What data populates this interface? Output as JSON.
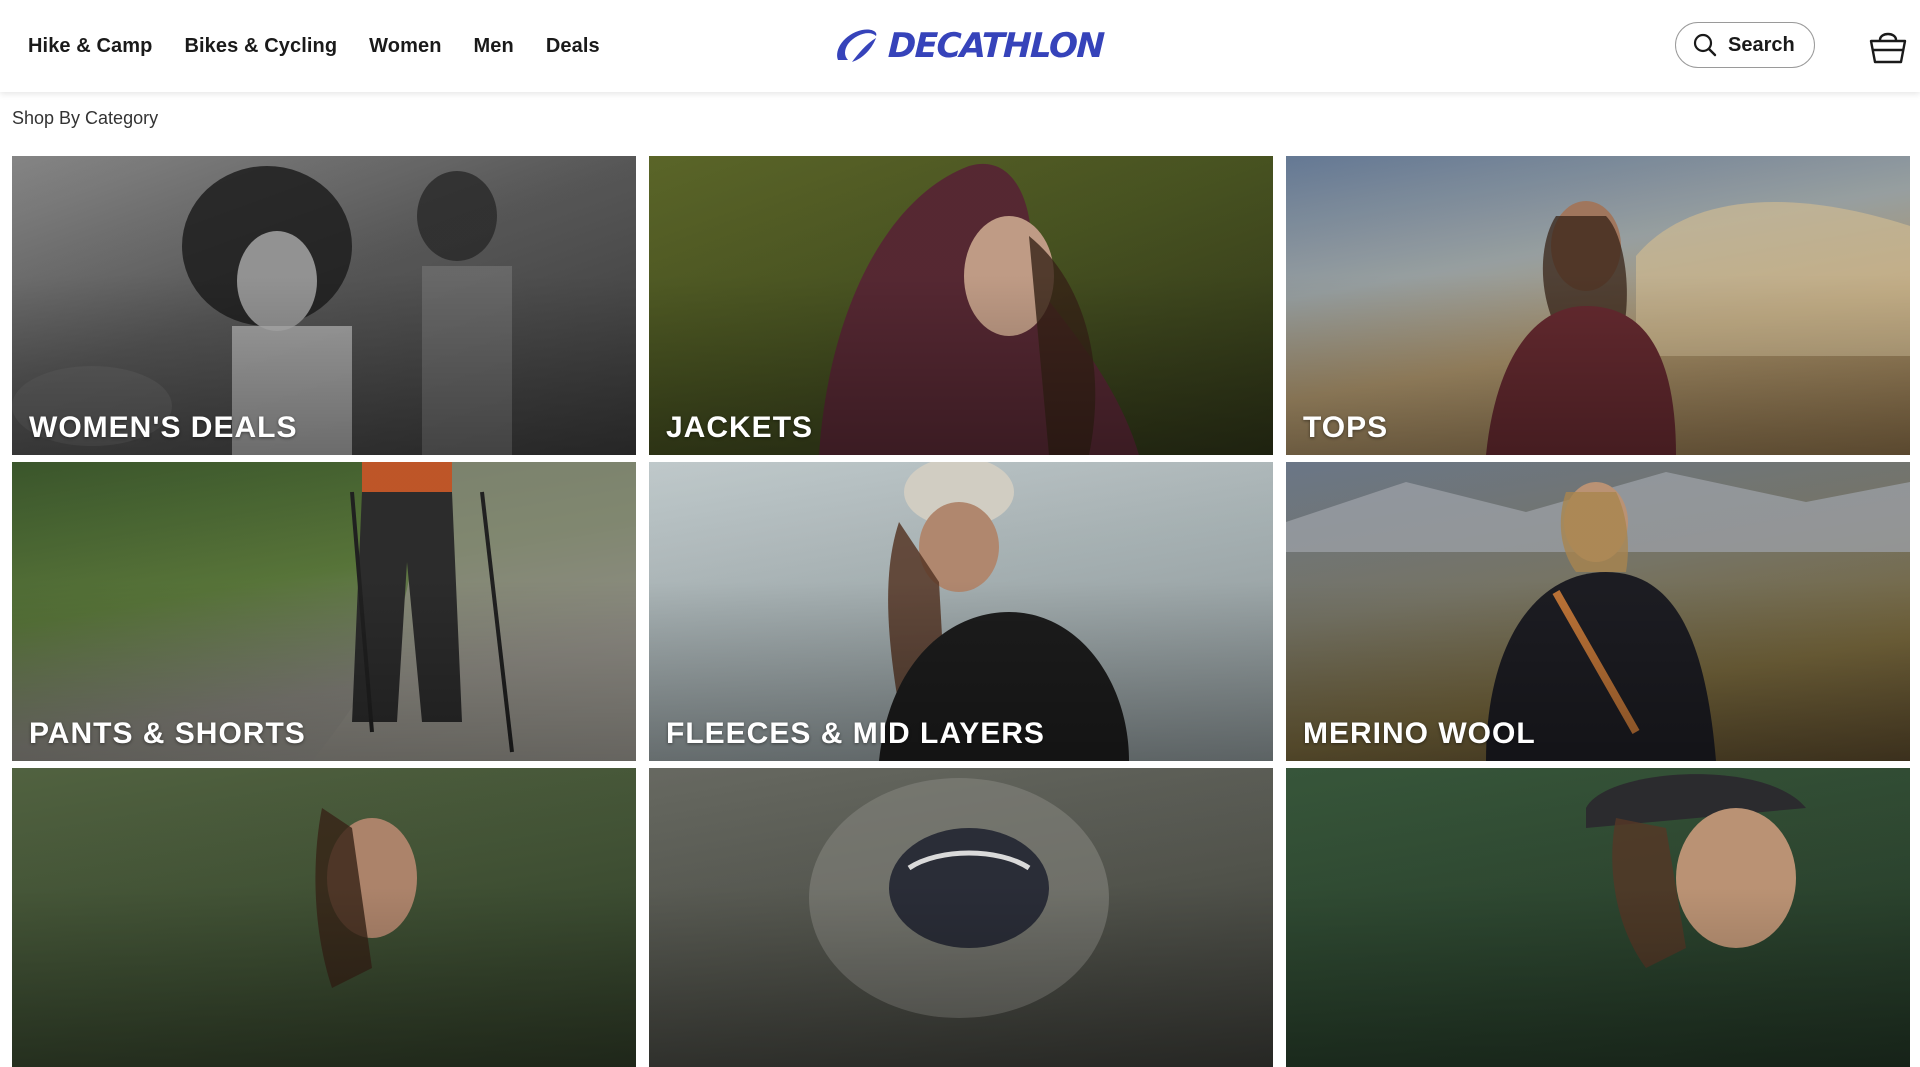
{
  "header": {
    "nav": [
      {
        "label": "Hike & Camp"
      },
      {
        "label": "Bikes & Cycling"
      },
      {
        "label": "Women"
      },
      {
        "label": "Men"
      },
      {
        "label": "Deals"
      }
    ],
    "logo_text": "DECATHLON",
    "search_label": "Search",
    "brand_color": "#3643ba"
  },
  "section": {
    "title": "Shop By Category"
  },
  "categories": [
    {
      "label": "WOMEN'S DEALS"
    },
    {
      "label": "JACKETS"
    },
    {
      "label": "TOPS"
    },
    {
      "label": "PANTS & SHORTS"
    },
    {
      "label": "FLEECES & MID LAYERS"
    },
    {
      "label": "MERINO WOOL"
    },
    {
      "label": ""
    },
    {
      "label": ""
    },
    {
      "label": ""
    }
  ],
  "icons": {
    "search": "search-icon",
    "cart": "basket-icon",
    "logo": "decathlon-logo-icon"
  }
}
